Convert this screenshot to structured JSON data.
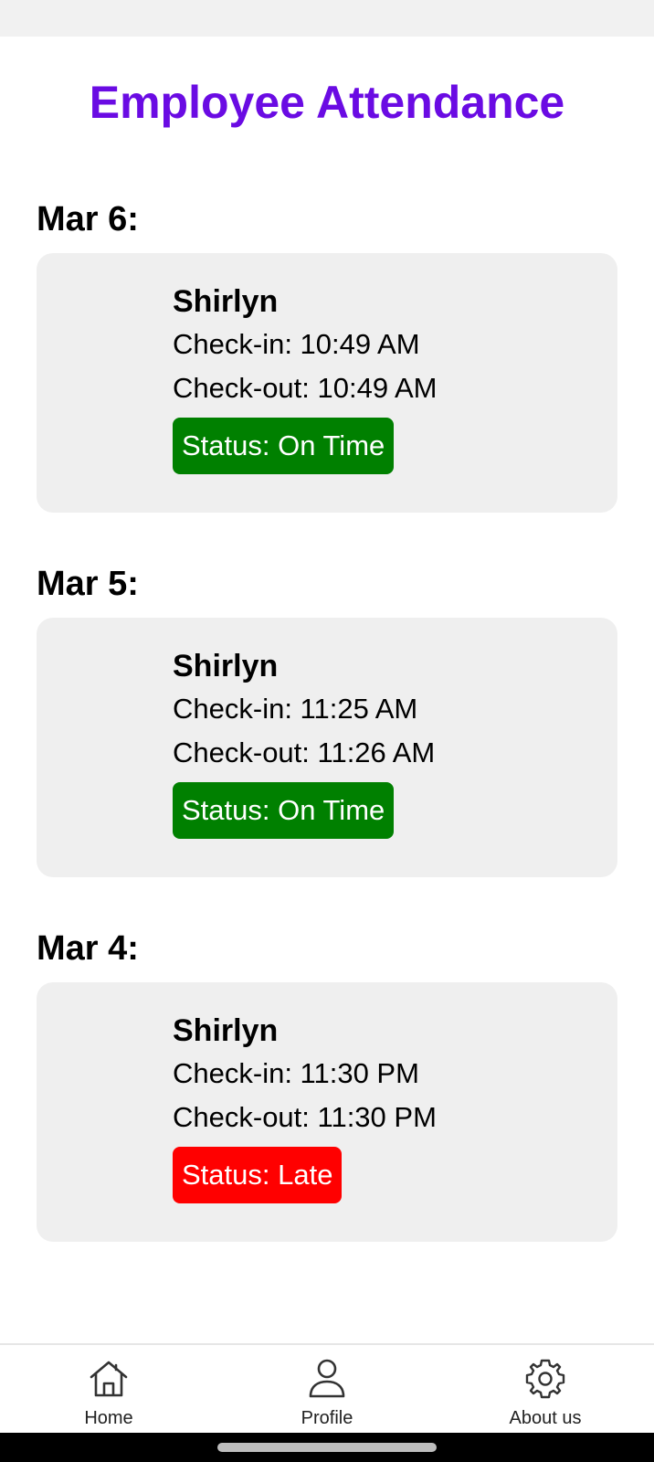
{
  "header": {
    "title": "Employee Attendance",
    "title_color": "#6a0be3"
  },
  "days": [
    {
      "date": "Mar 6:",
      "employee": "Shirlyn",
      "check_in": "Check-in: 10:49 AM",
      "check_out": "Check-out: 10:49 AM",
      "status": "Status: On Time",
      "status_color": "#008000"
    },
    {
      "date": "Mar 5:",
      "employee": "Shirlyn",
      "check_in": "Check-in: 11:25 AM",
      "check_out": "Check-out: 11:26 AM",
      "status": "Status: On Time",
      "status_color": "#008000"
    },
    {
      "date": "Mar 4:",
      "employee": "Shirlyn",
      "check_in": "Check-in: 11:30 PM",
      "check_out": "Check-out: 11:30 PM",
      "status": "Status: Late",
      "status_color": "#ff0000"
    }
  ],
  "bottom_nav": {
    "items": [
      {
        "label": "Home",
        "icon": "home-icon"
      },
      {
        "label": "Profile",
        "icon": "person-icon"
      },
      {
        "label": "About us",
        "icon": "gear-icon"
      }
    ]
  }
}
